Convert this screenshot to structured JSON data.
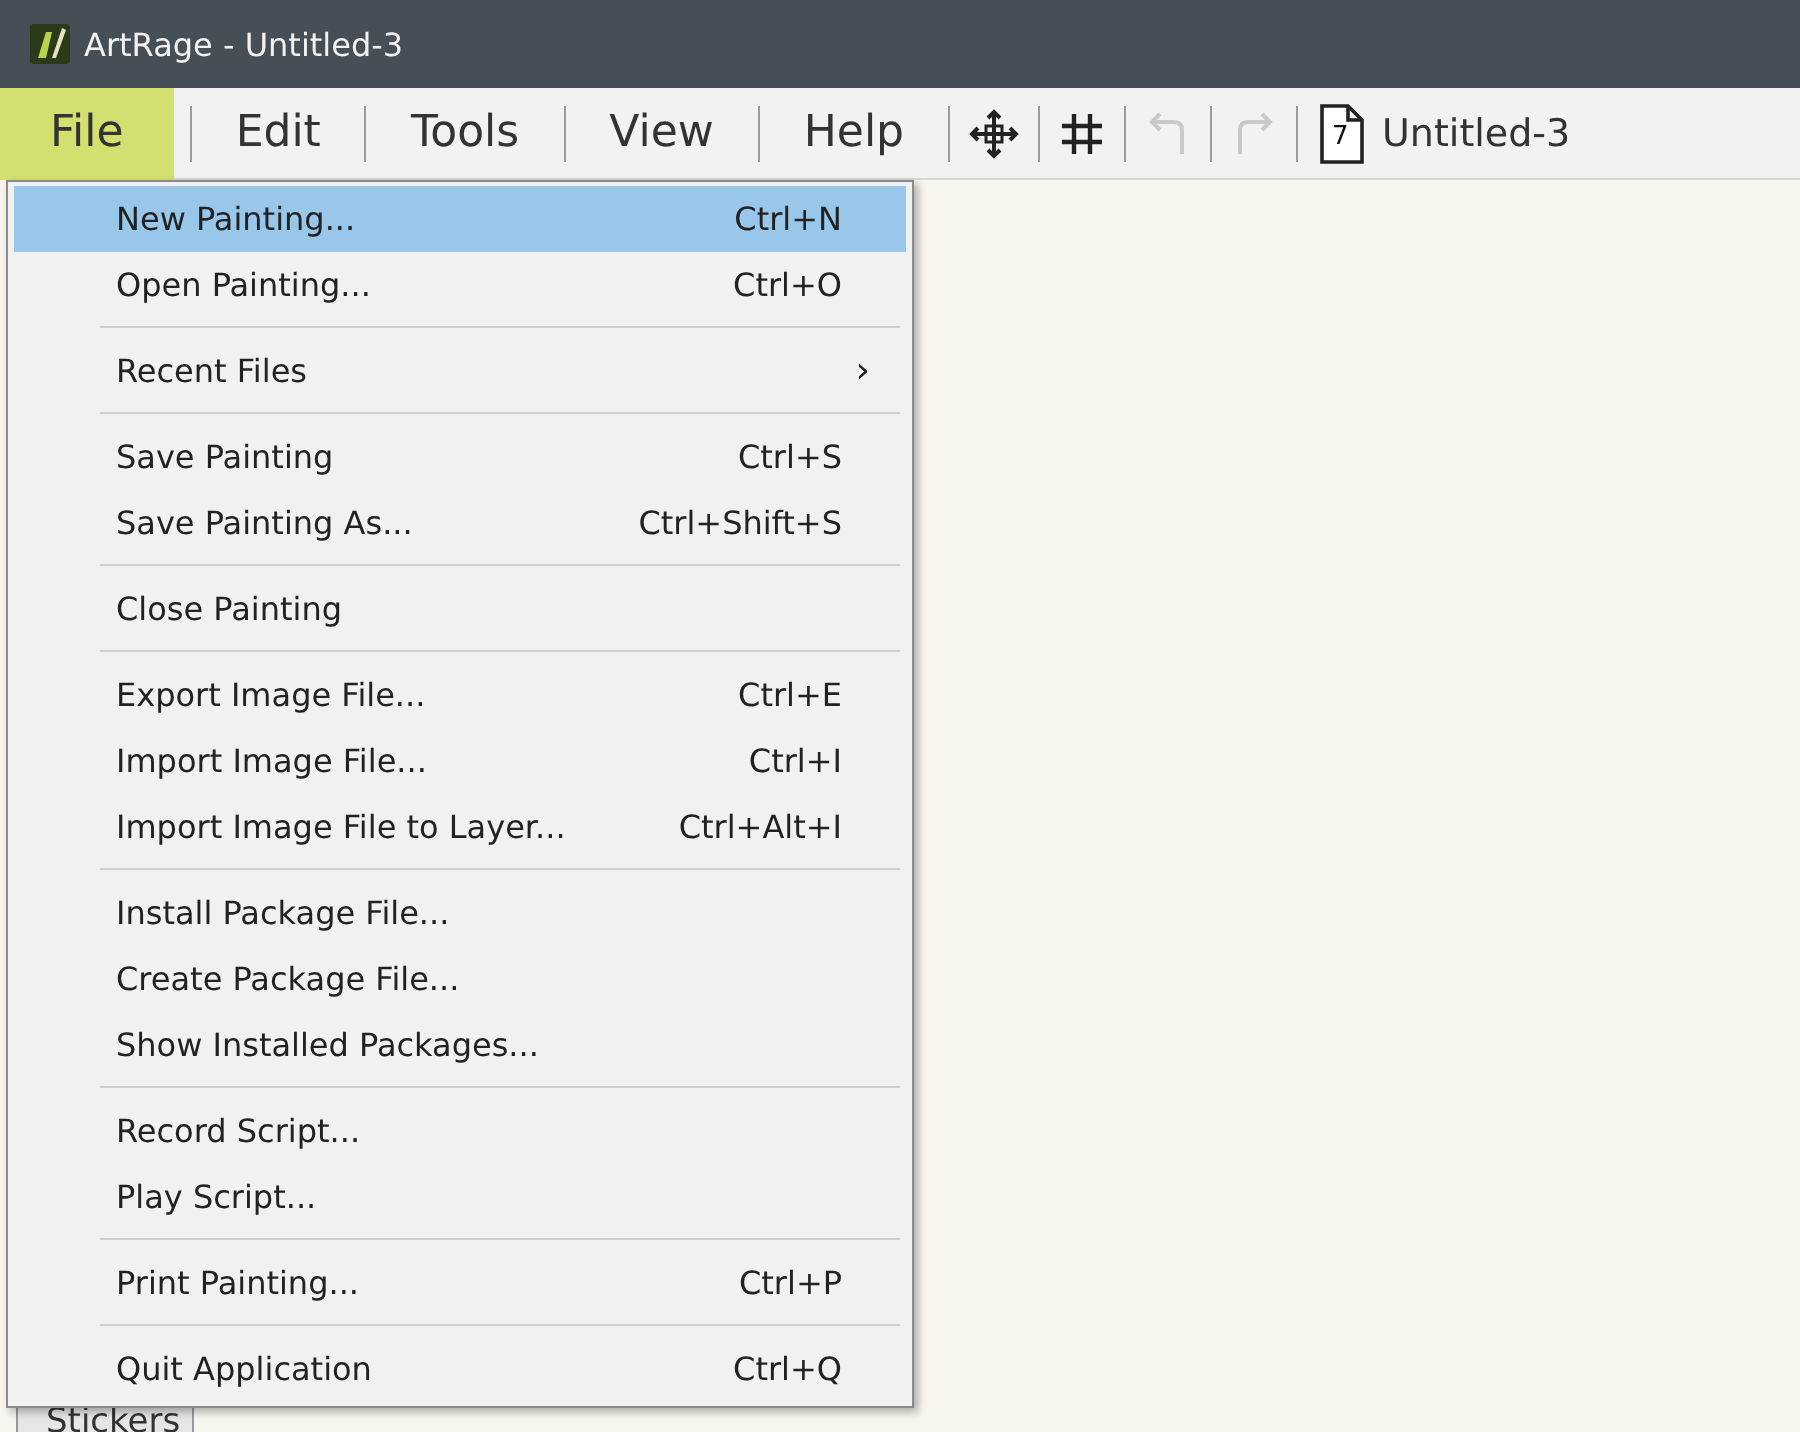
{
  "window": {
    "title": "ArtRage - Untitled-3"
  },
  "menubar": [
    {
      "label": "File",
      "selected": true
    },
    {
      "label": "Edit",
      "selected": false
    },
    {
      "label": "Tools",
      "selected": false
    },
    {
      "label": "View",
      "selected": false
    },
    {
      "label": "Help",
      "selected": false
    }
  ],
  "toolbar": [
    {
      "kind": "move",
      "disabled": false
    },
    {
      "kind": "grid",
      "disabled": false
    },
    {
      "kind": "undo",
      "disabled": true
    },
    {
      "kind": "redo",
      "disabled": true
    }
  ],
  "document": {
    "page_number": "7",
    "name": "Untitled-3"
  },
  "file_menu": [
    [
      {
        "label": "New Painting...",
        "shortcut": "Ctrl+N",
        "selected": true
      },
      {
        "label": "Open Painting...",
        "shortcut": "Ctrl+O",
        "selected": false
      }
    ],
    [
      {
        "label": "Recent Files",
        "submenu": "›",
        "selected": false
      }
    ],
    [
      {
        "label": "Save Painting",
        "shortcut": "Ctrl+S",
        "selected": false
      },
      {
        "label": "Save Painting As...",
        "shortcut": "Ctrl+Shift+S",
        "selected": false
      }
    ],
    [
      {
        "label": "Close Painting",
        "selected": false
      }
    ],
    [
      {
        "label": "Export Image File...",
        "shortcut": "Ctrl+E",
        "selected": false
      },
      {
        "label": "Import Image File...",
        "shortcut": "Ctrl+I",
        "selected": false
      },
      {
        "label": "Import Image File to Layer...",
        "shortcut": "Ctrl+Alt+I",
        "selected": false
      }
    ],
    [
      {
        "label": "Install Package File...",
        "selected": false
      },
      {
        "label": "Create Package File...",
        "selected": false
      },
      {
        "label": "Show Installed Packages...",
        "selected": false
      }
    ],
    [
      {
        "label": "Record Script...",
        "selected": false
      },
      {
        "label": "Play Script...",
        "selected": false
      }
    ],
    [
      {
        "label": "Print Painting...",
        "shortcut": "Ctrl+P",
        "selected": false
      }
    ],
    [
      {
        "label": "Quit Application",
        "shortcut": "Ctrl+Q",
        "selected": false
      }
    ]
  ],
  "panel_tabs": [
    {
      "label": "Stickers"
    }
  ]
}
